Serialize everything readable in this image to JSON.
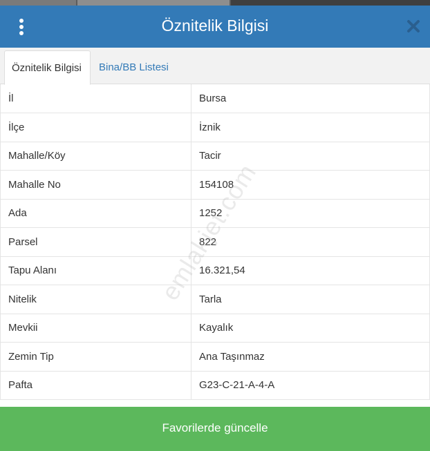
{
  "header": {
    "title": "Öznitelik Bilgisi",
    "menu_icon": "vertical-dots-icon",
    "close_icon": "close-icon",
    "color": "#337ab7"
  },
  "tabs": [
    {
      "label": "Öznitelik Bilgisi",
      "active": true
    },
    {
      "label": "Bina/BB Listesi",
      "active": false
    }
  ],
  "attributes": [
    {
      "key": "İl",
      "value": "Bursa"
    },
    {
      "key": "İlçe",
      "value": "İznik"
    },
    {
      "key": "Mahalle/Köy",
      "value": "Tacir"
    },
    {
      "key": "Mahalle No",
      "value": "154108"
    },
    {
      "key": "Ada",
      "value": "1252"
    },
    {
      "key": "Parsel",
      "value": "822"
    },
    {
      "key": "Tapu Alanı",
      "value": "16.321,54"
    },
    {
      "key": "Nitelik",
      "value": "Tarla"
    },
    {
      "key": "Mevkii",
      "value": "Kayalık"
    },
    {
      "key": "Zemin Tip",
      "value": "Ana Taşınmaz"
    },
    {
      "key": "Pafta",
      "value": "G23-C-21-A-4-A"
    }
  ],
  "watermark": "emlakjet.com",
  "footer": {
    "button_label": "Favorilerde güncelle",
    "color": "#5cb85c"
  }
}
